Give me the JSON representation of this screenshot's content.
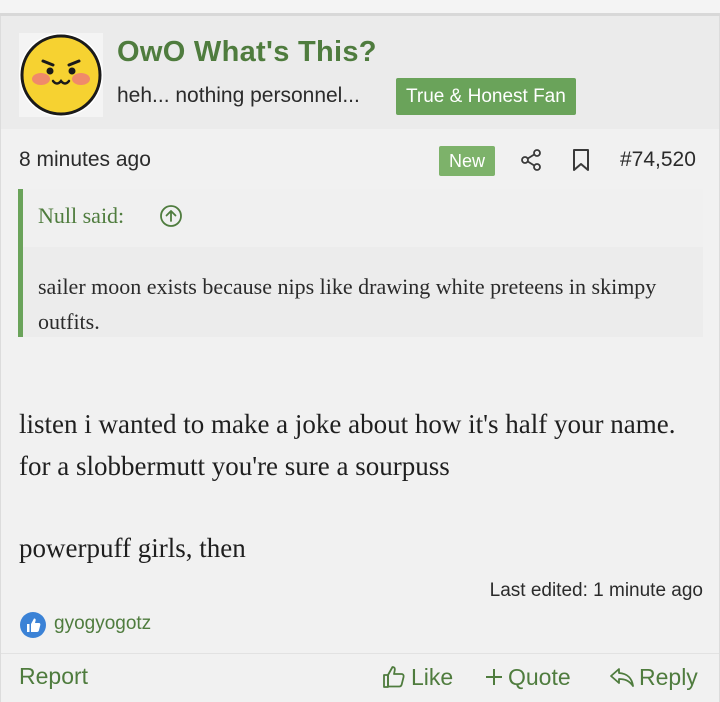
{
  "header": {
    "username": "OwO What's This?",
    "user_title": "heh... nothing personnel...",
    "banner": "True & Honest Fan"
  },
  "meta": {
    "time": "8 minutes ago",
    "badge": "New",
    "post_number": "#74,520"
  },
  "quote": {
    "author": "Null said:",
    "text": "sailer moon exists because nips like drawing white preteens in skimpy outfits."
  },
  "message": {
    "paragraph1": "listen i wanted to make a joke about how it's half your name. for a slobbermutt you're sure a sourpuss",
    "paragraph2": "powerpuff girls, then"
  },
  "last_edited": "Last edited: 1 minute ago",
  "reactions": {
    "users": "gyogyogotz"
  },
  "actions": {
    "report": "Report",
    "like": "Like",
    "quote": "Quote",
    "reply": "Reply"
  },
  "colors": {
    "accent": "#4f7c3e",
    "banner": "#6aa35a",
    "badge": "#7db26a",
    "avatar_face": "#f6d231"
  }
}
